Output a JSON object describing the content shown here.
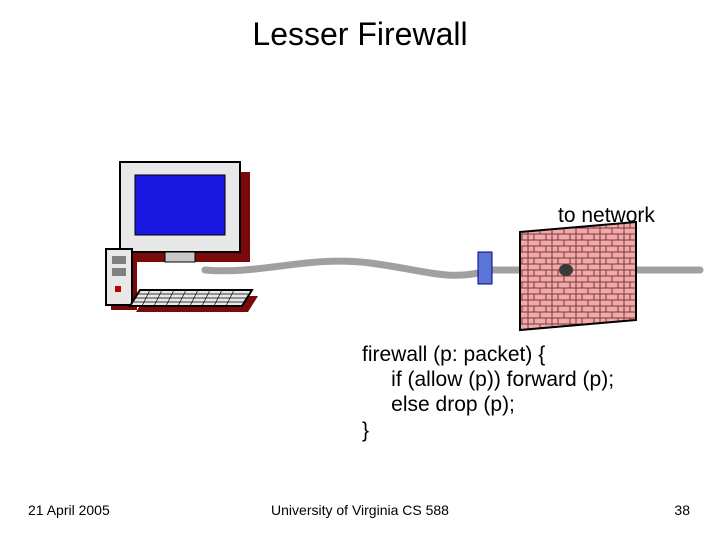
{
  "title": "Lesser Firewall",
  "labels": {
    "to_network": "to network"
  },
  "code": {
    "line1": "firewall (p: packet) {",
    "line2": "     if (allow (p)) forward (p);",
    "line3": "     else drop (p);",
    "line4": "}"
  },
  "footer": {
    "date": "21 April 2005",
    "center": "University of Virginia CS 588",
    "page": "38"
  },
  "icons": {
    "computer": "computer-icon",
    "firewall": "brick-wall-icon"
  },
  "colors": {
    "monitor_screen": "#1818e0",
    "wire": "#a0a0a0",
    "brick": "#f2a9a9",
    "brick_mortar": "#7a3a3a",
    "node": "#404040"
  }
}
